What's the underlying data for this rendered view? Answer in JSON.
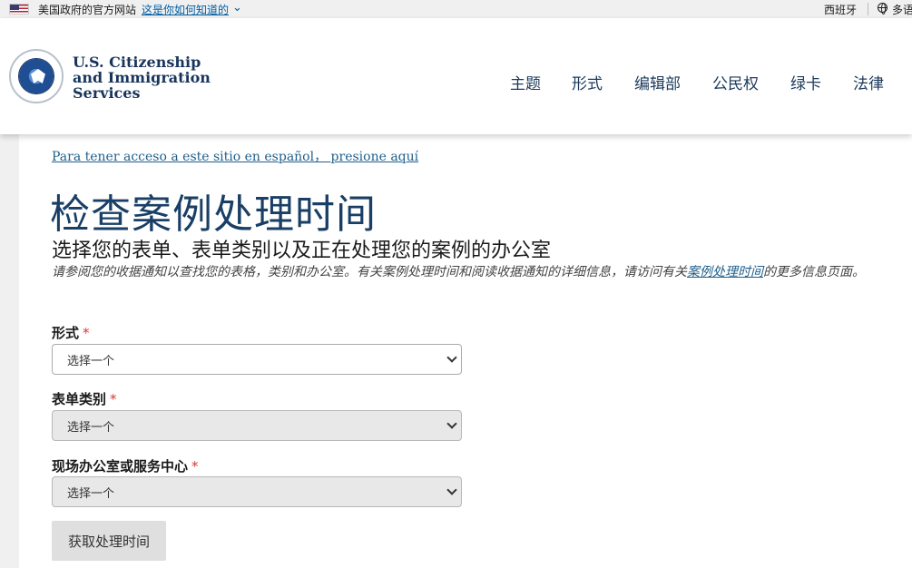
{
  "gov_banner": {
    "text": "美国政府的官方网站",
    "link": "这是你如何知道的",
    "language": "西班牙",
    "multi_language": "多语"
  },
  "header": {
    "brand_line1": "U.S. Citizenship",
    "brand_line2": "and Immigration",
    "brand_line3": "Services",
    "seal_icon": "dhs-seal-icon",
    "nav": [
      "主题",
      "形式",
      "编辑部",
      "公民权",
      "绿卡",
      "法律"
    ]
  },
  "main": {
    "spanish_link": "Para tener acceso a este sitio en español， presione aquí",
    "title": "检查案例处理时间",
    "subtitle": "选择您的表单、表单类别以及正在处理您的案例的办公室",
    "note_before": "请参阅您的收据通知以查找您的表格，类别和办公室。有关案例处理时间和阅读收据通知的详细信息，请访问有关",
    "note_link": "案例处理时间",
    "note_after": "的更多信息页面。",
    "fields": [
      {
        "label": "形式",
        "required": "*",
        "value": "选择一个",
        "disabled": false
      },
      {
        "label": "表单类别",
        "required": "*",
        "value": "选择一个",
        "disabled": true
      },
      {
        "label": "现场办公室或服务中心",
        "required": "*",
        "value": "选择一个",
        "disabled": true
      }
    ],
    "submit_label": "获取处理时间"
  },
  "colors": {
    "title": "#1a3f66",
    "link": "#1f5f8b",
    "required": "#d83933",
    "button_bg": "#dfdfdf"
  }
}
